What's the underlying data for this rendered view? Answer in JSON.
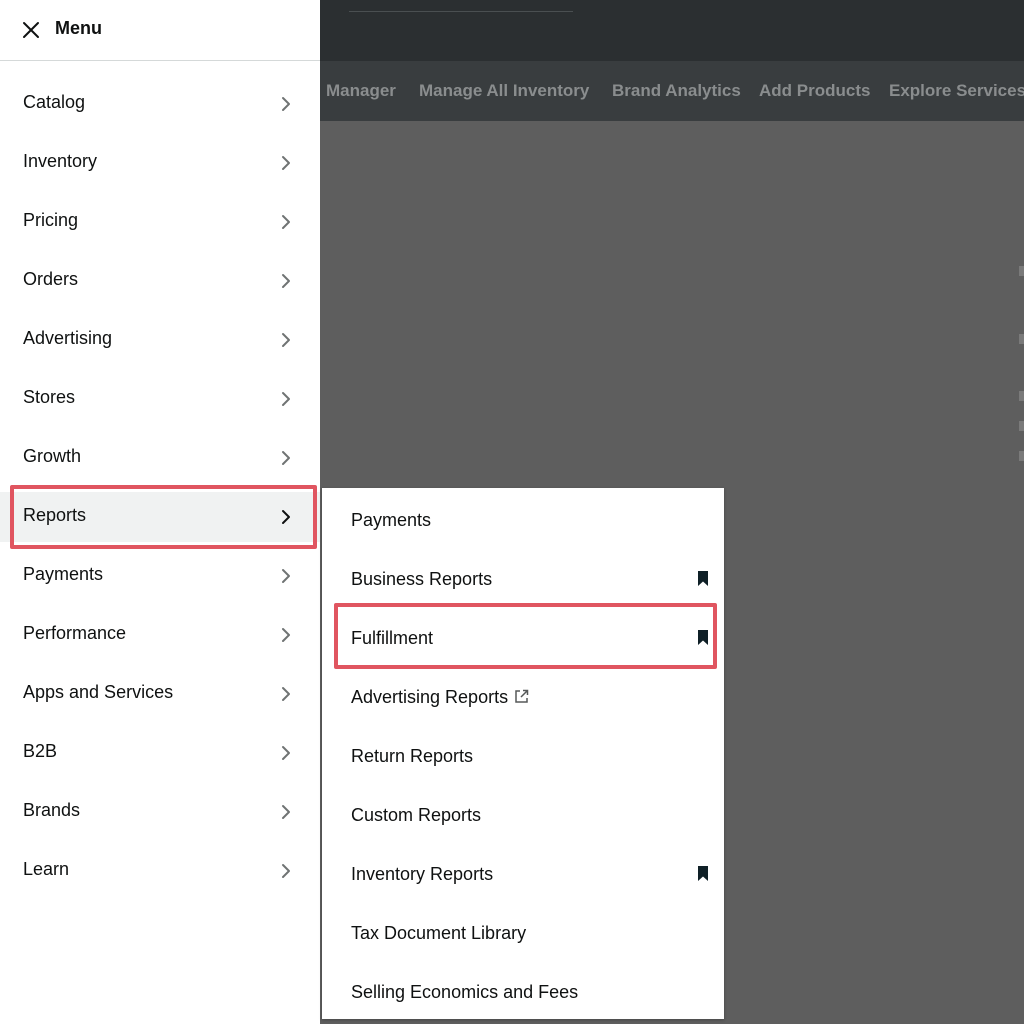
{
  "nav": {
    "links": [
      "Manager",
      "Manage All Inventory",
      "Brand Analytics",
      "Add Products",
      "Explore Services"
    ]
  },
  "menu": {
    "title": "Menu",
    "items": [
      {
        "label": "Catalog"
      },
      {
        "label": "Inventory"
      },
      {
        "label": "Pricing"
      },
      {
        "label": "Orders"
      },
      {
        "label": "Advertising"
      },
      {
        "label": "Stores"
      },
      {
        "label": "Growth"
      },
      {
        "label": "Reports",
        "selected": true
      },
      {
        "label": "Payments"
      },
      {
        "label": "Performance"
      },
      {
        "label": "Apps and Services"
      },
      {
        "label": "B2B"
      },
      {
        "label": "Brands"
      },
      {
        "label": "Learn"
      }
    ]
  },
  "submenu": {
    "items": [
      {
        "label": "Payments",
        "bookmarked": false
      },
      {
        "label": "Business Reports",
        "bookmarked": true
      },
      {
        "label": "Fulfillment",
        "bookmarked": true,
        "highlighted": true
      },
      {
        "label": "Advertising Reports",
        "bookmarked": false,
        "external": true
      },
      {
        "label": "Return Reports",
        "bookmarked": false
      },
      {
        "label": "Custom Reports",
        "bookmarked": false
      },
      {
        "label": "Inventory Reports",
        "bookmarked": true
      },
      {
        "label": "Tax Document Library",
        "bookmarked": false
      },
      {
        "label": "Selling Economics and Fees",
        "bookmarked": false
      }
    ]
  },
  "icons": {
    "close": "close-icon",
    "chevron": "chevron-right-icon",
    "bookmark": "bookmark-icon",
    "external": "external-link-icon"
  },
  "colors": {
    "highlight": "#e05560",
    "topbar": "#2b2f31",
    "navbar": "#393d3f",
    "overlay": "#5e5e5e",
    "text": "#0f1111"
  }
}
